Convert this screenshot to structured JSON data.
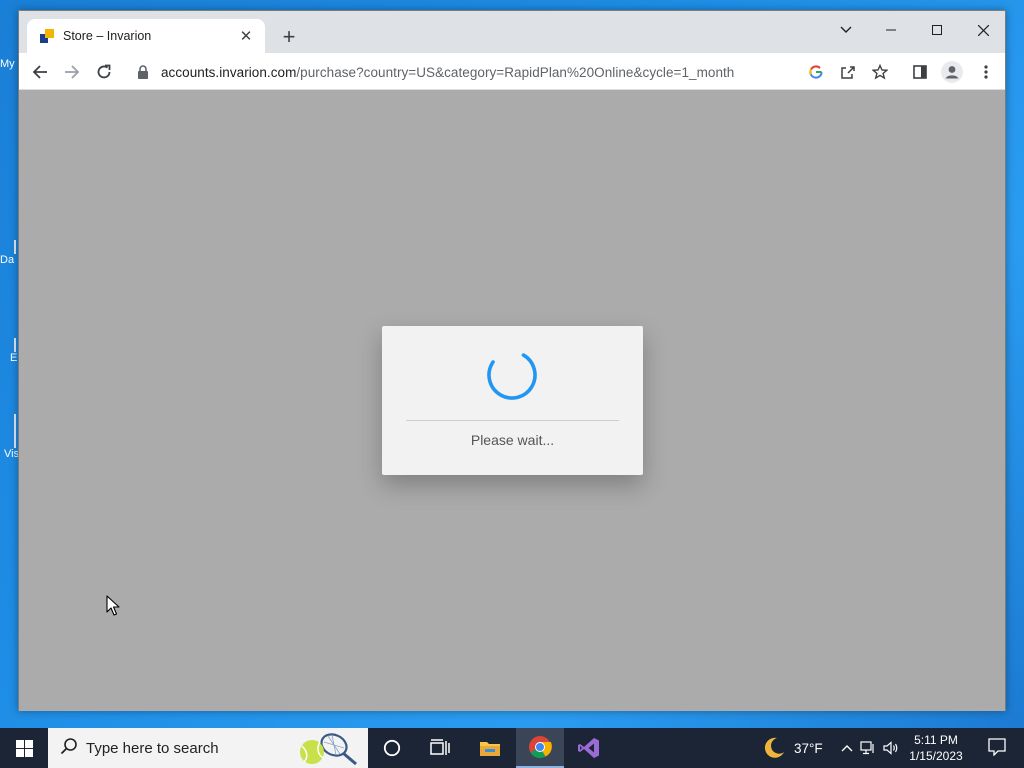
{
  "desktop": {
    "icons": [
      {
        "label": "My"
      },
      {
        "label": "Da"
      },
      {
        "label": "E"
      },
      {
        "label": "Vis"
      }
    ]
  },
  "browser": {
    "tab": {
      "title": "Store – Invarion",
      "close": "✕"
    },
    "new_tab": "+",
    "url": {
      "host": "accounts.invarion.com",
      "path": "/purchase?country=US&category=RapidPlan%20Online&cycle=1_month"
    }
  },
  "dialog": {
    "message": "Please wait...",
    "spinner_color": "#2196f3"
  },
  "taskbar": {
    "search_placeholder": "Type here to search",
    "weather": "37°F",
    "time": "5:11 PM",
    "date": "1/15/2023"
  },
  "colors": {
    "page_background": "#ababab",
    "taskbar": "#1b2535",
    "desktop": "#1f8ee6"
  }
}
